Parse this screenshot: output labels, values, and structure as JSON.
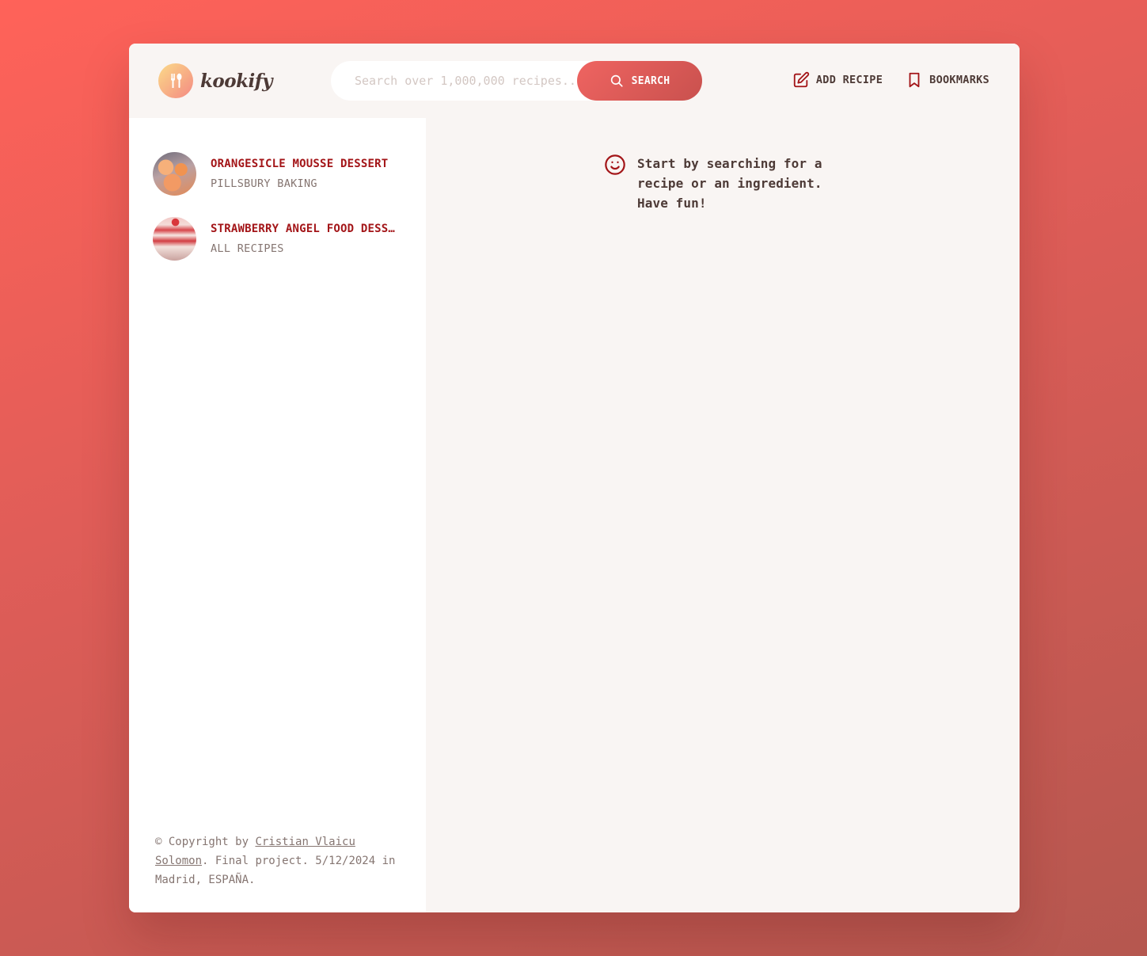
{
  "brand": {
    "name": "kookify",
    "logo_icon": "fork-spoon-icon"
  },
  "search": {
    "placeholder": "Search over 1,000,000 recipes...",
    "button_label": "SEARCH",
    "icon": "search-icon"
  },
  "nav": {
    "add_recipe": "ADD RECIPE",
    "add_recipe_icon": "edit-icon",
    "bookmarks": "BOOKMARKS",
    "bookmarks_icon": "bookmark-icon"
  },
  "results": [
    {
      "title": "ORANGESICLE MOUSSE DESSERT",
      "publisher": "PILLSBURY BAKING"
    },
    {
      "title": "STRAWBERRY ANGEL FOOD DESSERT",
      "publisher": "ALL RECIPES"
    }
  ],
  "footer": {
    "prefix": "© Copyright by ",
    "author": "Cristian Vlaicu Solomon",
    "suffix": ". Final project. 5/12/2024 in Madrid, ESPAÑA."
  },
  "message": {
    "icon": "smile-icon",
    "text": "Start by searching for a recipe or an ingredient. Have fun!"
  },
  "colors": {
    "accent": "#a31518",
    "gradient_start": "#ff6259",
    "gradient_end": "#b5574f",
    "text_dark": "#4d3a36",
    "text_muted": "#857571"
  }
}
